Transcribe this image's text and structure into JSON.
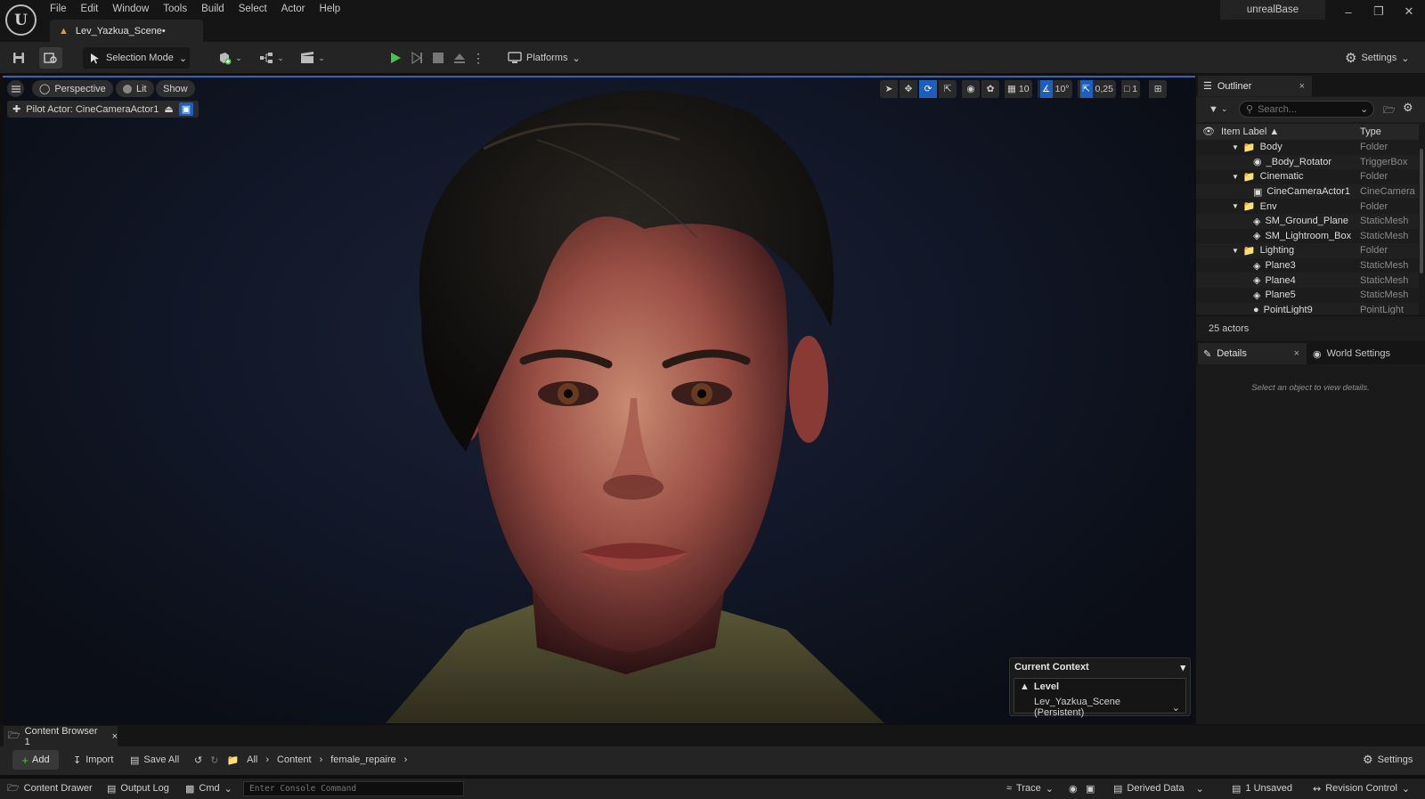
{
  "titlebar": {
    "menu": [
      "File",
      "Edit",
      "Window",
      "Tools",
      "Build",
      "Select",
      "Actor",
      "Help"
    ],
    "project": "unrealBase",
    "document_tab": "Lev_Yazkua_Scene•"
  },
  "toolbar": {
    "selection_mode": "Selection Mode",
    "platforms": "Platforms",
    "settings": "Settings"
  },
  "viewport": {
    "perspective": "Perspective",
    "lit": "Lit",
    "show": "Show",
    "pilot_actor": "Pilot Actor: CineCameraActor1",
    "grid_snap": "10",
    "rotation_snap": "10°",
    "scale_snap": "0,25",
    "camera_speed": "1",
    "context": {
      "title": "Current Context",
      "level_label": "Level",
      "level_value": "Lev_Yazkua_Scene (Persistent)"
    }
  },
  "outliner": {
    "tab": "Outliner",
    "search_placeholder": "Search...",
    "col_label": "Item Label ▲",
    "col_type": "Type",
    "rows": [
      {
        "label": "Body",
        "type": "Folder"
      },
      {
        "label": "_Body_Rotator",
        "type": "TriggerBox"
      },
      {
        "label": "Cinematic",
        "type": "Folder"
      },
      {
        "label": "CineCameraActor1",
        "type": "CineCamera"
      },
      {
        "label": "Env",
        "type": "Folder"
      },
      {
        "label": "SM_Ground_Plane",
        "type": "StaticMesh"
      },
      {
        "label": "SM_Lightroom_Box",
        "type": "StaticMesh"
      },
      {
        "label": "Lighting",
        "type": "Folder"
      },
      {
        "label": "Plane3",
        "type": "StaticMesh"
      },
      {
        "label": "Plane4",
        "type": "StaticMesh"
      },
      {
        "label": "Plane5",
        "type": "StaticMesh"
      },
      {
        "label": "PointLight9",
        "type": "PointLight"
      }
    ],
    "count": "25 actors"
  },
  "details": {
    "tab": "Details",
    "world_settings": "World Settings",
    "empty": "Select an object to view details."
  },
  "content_browser": {
    "tab": "Content Browser 1",
    "add": "Add",
    "import": "Import",
    "save_all": "Save All",
    "crumbs": [
      "All",
      "Content",
      "female_repaire"
    ],
    "settings": "Settings"
  },
  "statusbar": {
    "content_drawer": "Content Drawer",
    "output_log": "Output Log",
    "cmd": "Cmd",
    "console_placeholder": "Enter Console Command",
    "trace": "Trace",
    "derived_data": "Derived Data",
    "unsaved": "1 Unsaved",
    "revision_control": "Revision Control"
  },
  "colors": {
    "accent": "#1b5fc0",
    "play": "#4ac24a",
    "folder": "#c99a4a"
  }
}
